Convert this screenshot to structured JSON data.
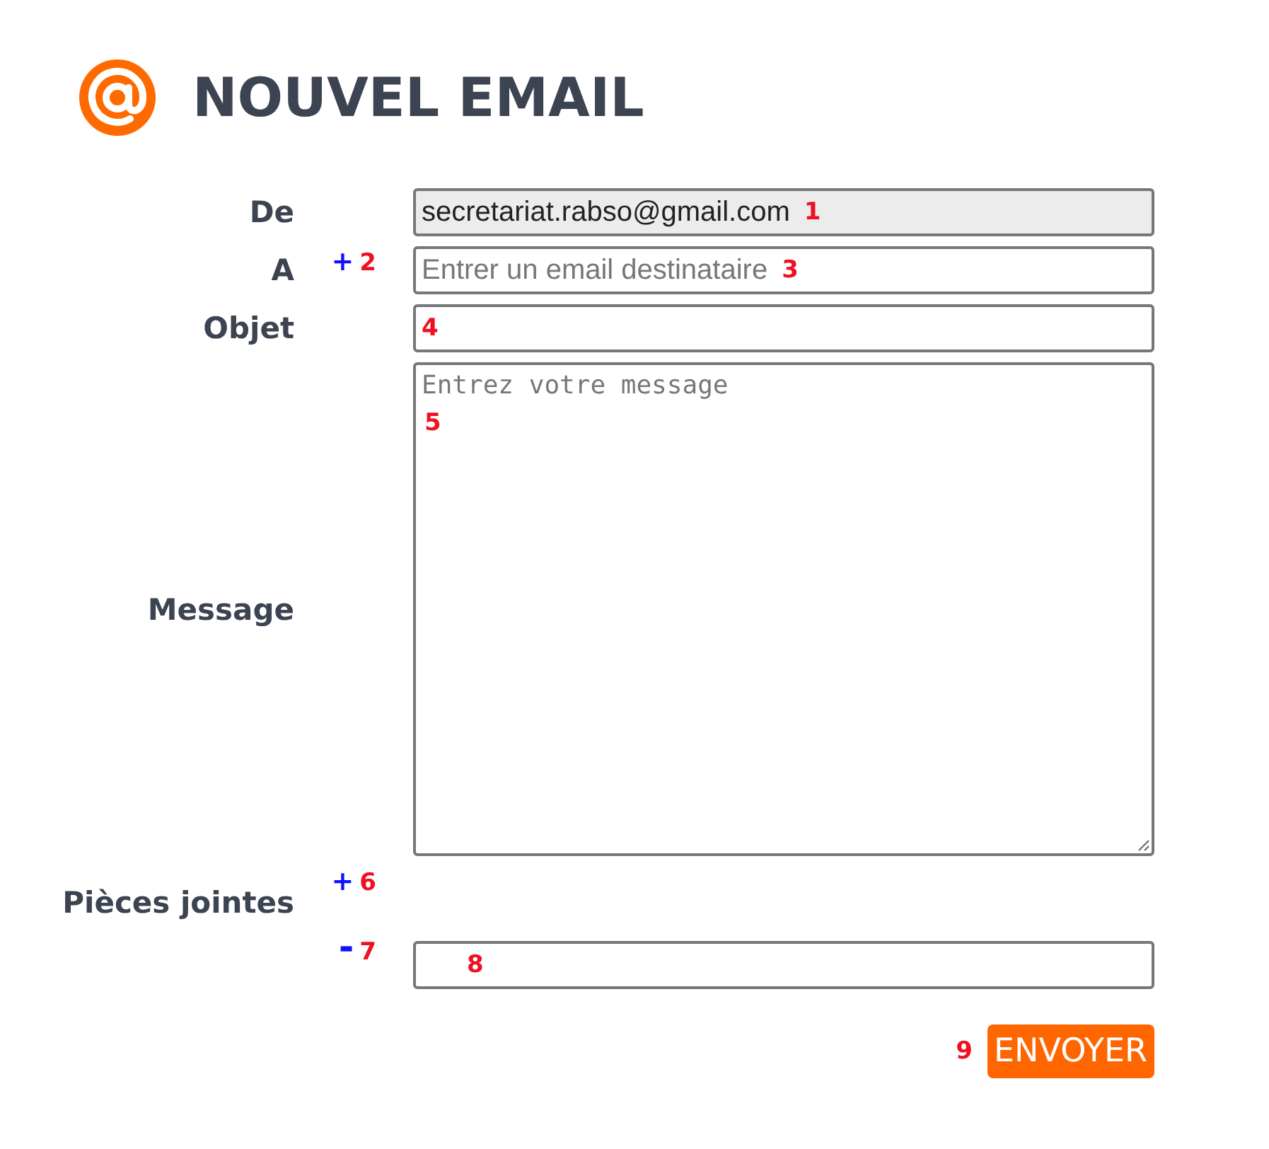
{
  "title": "NOUVEL EMAIL",
  "fields": [
    {
      "kind": "input",
      "label": "De",
      "value": "secretariat.rabso@gmail.com",
      "marker": "1",
      "readonly": true
    },
    {
      "kind": "input",
      "label": "A",
      "action": "+",
      "action_marker": "2",
      "placeholder": "Entrer un email destinataire",
      "marker": "3",
      "readonly": false
    },
    {
      "kind": "input",
      "label": "Objet",
      "marker": "4",
      "readonly": false
    },
    {
      "kind": "textarea",
      "label": "Message",
      "placeholder": "Entrez votre message",
      "marker": "5",
      "readonly": false
    }
  ],
  "attachments": {
    "label": "Pièces jointes",
    "action": "+",
    "action_marker": "6",
    "rows": [
      {
        "action": "-",
        "action_marker": "7",
        "marker": "8"
      }
    ]
  },
  "submit": {
    "label": "ENVOYER",
    "marker": "9"
  }
}
